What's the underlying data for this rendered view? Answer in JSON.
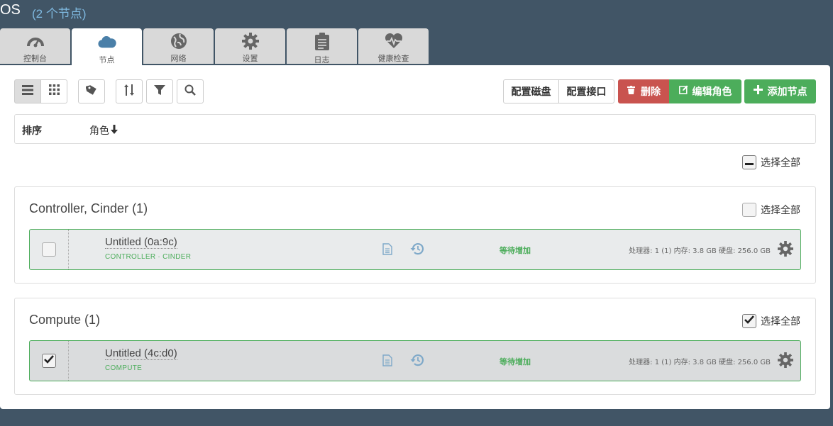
{
  "header": {
    "env_name": "OS",
    "node_count": "(2 个节点)"
  },
  "tabs": [
    {
      "label": "控制台",
      "icon": "dashboard-icon"
    },
    {
      "label": "节点",
      "icon": "cloud-icon",
      "active": true
    },
    {
      "label": "网络",
      "icon": "globe-icon"
    },
    {
      "label": "设置",
      "icon": "gear-icon"
    },
    {
      "label": "日志",
      "icon": "clipboard-icon"
    },
    {
      "label": "健康检查",
      "icon": "heartbeat-icon"
    }
  ],
  "toolbar": {
    "config_disks": "配置磁盘",
    "config_interfaces": "配置接口",
    "delete": "删除",
    "edit_roles": "编辑角色",
    "add_nodes": "添加节点"
  },
  "sorting": {
    "label": "排序",
    "role": "角色"
  },
  "select_all_label": "选择全部",
  "groups": [
    {
      "title": "Controller, Cinder (1)",
      "nodes": [
        {
          "name": "Untitled (0a:9c)",
          "roles": "CONTROLLER · CINDER",
          "status": "等待增加",
          "specs": "处理器: 1 (1)  内存: 3.8 GB  硬盘: 256.0 GB",
          "checked": false
        }
      ]
    },
    {
      "title": "Compute (1)",
      "nodes": [
        {
          "name": "Untitled (4c:d0)",
          "roles": "COMPUTE",
          "status": "等待增加",
          "specs": "处理器: 1 (1)  内存: 3.8 GB  硬盘: 256.0 GB",
          "checked": true
        }
      ]
    }
  ],
  "colors": {
    "background": "#415566",
    "accent_green": "#4cad5b",
    "danger_red": "#c9534f",
    "link_blue": "#7fb9e0"
  }
}
